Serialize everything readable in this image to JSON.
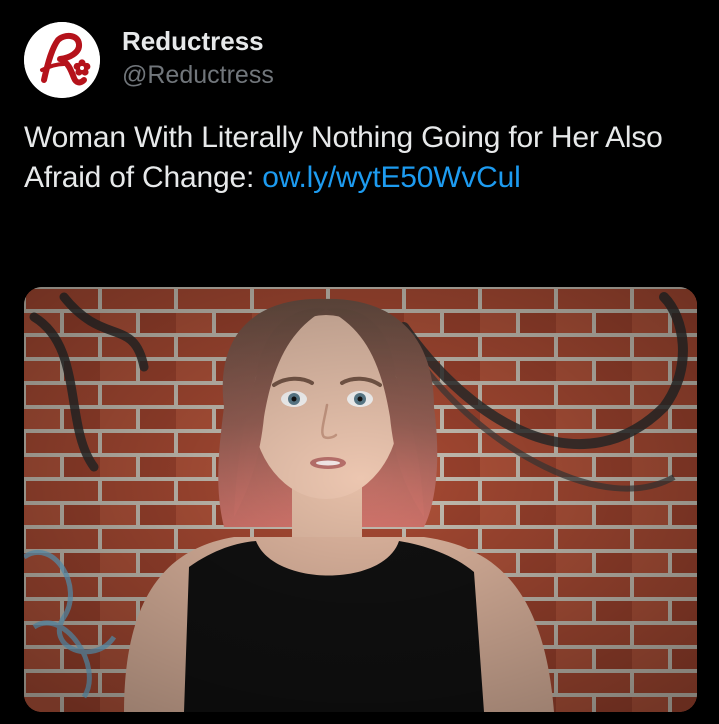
{
  "tweet": {
    "author": {
      "display_name": "Reductress",
      "handle": "@Reductress",
      "avatar_icon": "reductress-logo-icon",
      "brand_color": "#b5121b"
    },
    "text": "Woman With Literally Nothing Going for Her Also Afraid of Change: ",
    "link": "ow.ly/wytE50WvCul",
    "link_color": "#1d9bf0",
    "media": {
      "type": "photo",
      "subject": "woman-against-brick-wall"
    }
  },
  "colors": {
    "background": "#000000",
    "text": "#e7e9ea",
    "secondary_text": "#71767b"
  }
}
